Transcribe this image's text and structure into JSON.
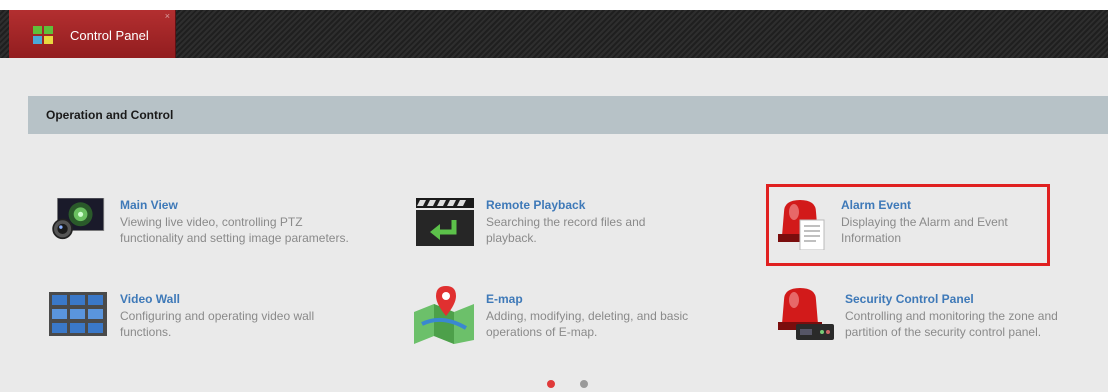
{
  "tab": {
    "label": "Control Panel",
    "icon": "control-panel-icon",
    "close": "×"
  },
  "section": {
    "title": "Operation and Control"
  },
  "modules": [
    {
      "title": "Main View",
      "desc": "Viewing live video, controlling PTZ functionality and setting image parameters.",
      "icon": "camera-icon"
    },
    {
      "title": "Remote Playback",
      "desc": "Searching the record files and playback.",
      "icon": "playback-icon"
    },
    {
      "title": "Alarm Event",
      "desc": "Displaying the Alarm and Event Information",
      "icon": "alarm-icon"
    },
    {
      "title": "Video Wall",
      "desc": "Configuring and operating video wall functions.",
      "icon": "video-wall-icon"
    },
    {
      "title": "E-map",
      "desc": "Adding, modifying, deleting, and basic operations of E-map.",
      "icon": "map-icon"
    },
    {
      "title": "Security Control Panel",
      "desc": "Controlling and monitoring the zone and partition of the security control panel.",
      "icon": "security-panel-icon"
    }
  ],
  "pager": {
    "pages": 2,
    "current": 1,
    "active_color": "#e03a3a",
    "inactive_color": "#9a9a9a"
  },
  "colors": {
    "accent": "#b32f30",
    "link": "#3e79b8",
    "highlight": "#e02020"
  }
}
